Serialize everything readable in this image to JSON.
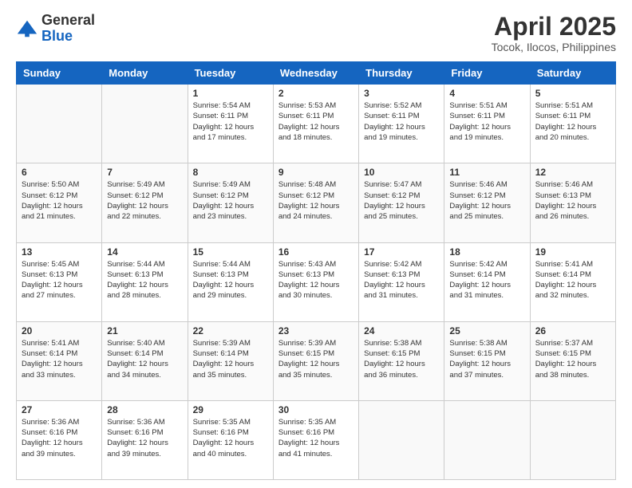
{
  "logo": {
    "general": "General",
    "blue": "Blue"
  },
  "header": {
    "title": "April 2025",
    "subtitle": "Tocok, Ilocos, Philippines"
  },
  "weekdays": [
    "Sunday",
    "Monday",
    "Tuesday",
    "Wednesday",
    "Thursday",
    "Friday",
    "Saturday"
  ],
  "weeks": [
    [
      {
        "day": "",
        "info": ""
      },
      {
        "day": "",
        "info": ""
      },
      {
        "day": "1",
        "info": "Sunrise: 5:54 AM\nSunset: 6:11 PM\nDaylight: 12 hours and 17 minutes."
      },
      {
        "day": "2",
        "info": "Sunrise: 5:53 AM\nSunset: 6:11 PM\nDaylight: 12 hours and 18 minutes."
      },
      {
        "day": "3",
        "info": "Sunrise: 5:52 AM\nSunset: 6:11 PM\nDaylight: 12 hours and 19 minutes."
      },
      {
        "day": "4",
        "info": "Sunrise: 5:51 AM\nSunset: 6:11 PM\nDaylight: 12 hours and 19 minutes."
      },
      {
        "day": "5",
        "info": "Sunrise: 5:51 AM\nSunset: 6:11 PM\nDaylight: 12 hours and 20 minutes."
      }
    ],
    [
      {
        "day": "6",
        "info": "Sunrise: 5:50 AM\nSunset: 6:12 PM\nDaylight: 12 hours and 21 minutes."
      },
      {
        "day": "7",
        "info": "Sunrise: 5:49 AM\nSunset: 6:12 PM\nDaylight: 12 hours and 22 minutes."
      },
      {
        "day": "8",
        "info": "Sunrise: 5:49 AM\nSunset: 6:12 PM\nDaylight: 12 hours and 23 minutes."
      },
      {
        "day": "9",
        "info": "Sunrise: 5:48 AM\nSunset: 6:12 PM\nDaylight: 12 hours and 24 minutes."
      },
      {
        "day": "10",
        "info": "Sunrise: 5:47 AM\nSunset: 6:12 PM\nDaylight: 12 hours and 25 minutes."
      },
      {
        "day": "11",
        "info": "Sunrise: 5:46 AM\nSunset: 6:12 PM\nDaylight: 12 hours and 25 minutes."
      },
      {
        "day": "12",
        "info": "Sunrise: 5:46 AM\nSunset: 6:13 PM\nDaylight: 12 hours and 26 minutes."
      }
    ],
    [
      {
        "day": "13",
        "info": "Sunrise: 5:45 AM\nSunset: 6:13 PM\nDaylight: 12 hours and 27 minutes."
      },
      {
        "day": "14",
        "info": "Sunrise: 5:44 AM\nSunset: 6:13 PM\nDaylight: 12 hours and 28 minutes."
      },
      {
        "day": "15",
        "info": "Sunrise: 5:44 AM\nSunset: 6:13 PM\nDaylight: 12 hours and 29 minutes."
      },
      {
        "day": "16",
        "info": "Sunrise: 5:43 AM\nSunset: 6:13 PM\nDaylight: 12 hours and 30 minutes."
      },
      {
        "day": "17",
        "info": "Sunrise: 5:42 AM\nSunset: 6:13 PM\nDaylight: 12 hours and 31 minutes."
      },
      {
        "day": "18",
        "info": "Sunrise: 5:42 AM\nSunset: 6:14 PM\nDaylight: 12 hours and 31 minutes."
      },
      {
        "day": "19",
        "info": "Sunrise: 5:41 AM\nSunset: 6:14 PM\nDaylight: 12 hours and 32 minutes."
      }
    ],
    [
      {
        "day": "20",
        "info": "Sunrise: 5:41 AM\nSunset: 6:14 PM\nDaylight: 12 hours and 33 minutes."
      },
      {
        "day": "21",
        "info": "Sunrise: 5:40 AM\nSunset: 6:14 PM\nDaylight: 12 hours and 34 minutes."
      },
      {
        "day": "22",
        "info": "Sunrise: 5:39 AM\nSunset: 6:14 PM\nDaylight: 12 hours and 35 minutes."
      },
      {
        "day": "23",
        "info": "Sunrise: 5:39 AM\nSunset: 6:15 PM\nDaylight: 12 hours and 35 minutes."
      },
      {
        "day": "24",
        "info": "Sunrise: 5:38 AM\nSunset: 6:15 PM\nDaylight: 12 hours and 36 minutes."
      },
      {
        "day": "25",
        "info": "Sunrise: 5:38 AM\nSunset: 6:15 PM\nDaylight: 12 hours and 37 minutes."
      },
      {
        "day": "26",
        "info": "Sunrise: 5:37 AM\nSunset: 6:15 PM\nDaylight: 12 hours and 38 minutes."
      }
    ],
    [
      {
        "day": "27",
        "info": "Sunrise: 5:36 AM\nSunset: 6:16 PM\nDaylight: 12 hours and 39 minutes."
      },
      {
        "day": "28",
        "info": "Sunrise: 5:36 AM\nSunset: 6:16 PM\nDaylight: 12 hours and 39 minutes."
      },
      {
        "day": "29",
        "info": "Sunrise: 5:35 AM\nSunset: 6:16 PM\nDaylight: 12 hours and 40 minutes."
      },
      {
        "day": "30",
        "info": "Sunrise: 5:35 AM\nSunset: 6:16 PM\nDaylight: 12 hours and 41 minutes."
      },
      {
        "day": "",
        "info": ""
      },
      {
        "day": "",
        "info": ""
      },
      {
        "day": "",
        "info": ""
      }
    ]
  ]
}
